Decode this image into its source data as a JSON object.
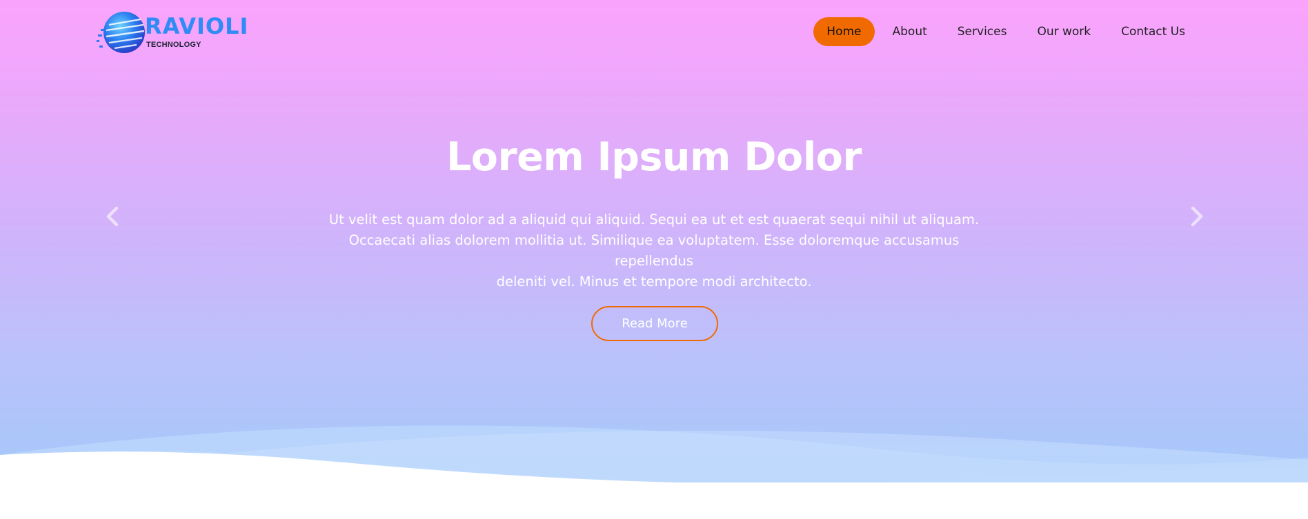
{
  "brand": {
    "name": "RAVIOLI",
    "tagline": "TECHNOLOGY",
    "logo_icon": "globe-logo-icon",
    "name_color": "#2f8cf5"
  },
  "nav": {
    "items": [
      {
        "label": "Home",
        "active": true
      },
      {
        "label": "About",
        "active": false
      },
      {
        "label": "Services",
        "active": false
      },
      {
        "label": "Our work",
        "active": false
      },
      {
        "label": "Contact Us",
        "active": false
      }
    ],
    "active_color": "#f06a00"
  },
  "hero": {
    "title": "Lorem Ipsum Dolor",
    "lines": [
      "Ut velit est quam dolor ad a aliquid qui aliquid. Sequi ea ut et est quaerat sequi nihil ut aliquam.",
      "Occaecati alias dolorem mollitia ut. Similique ea voluptatem. Esse doloremque accusamus repellendus",
      "deleniti vel. Minus et tempore modi architecto."
    ],
    "button_label": "Read More",
    "prev_icon": "chevron-left-icon",
    "next_icon": "chevron-right-icon",
    "gradient_top": "#fba3fd",
    "gradient_bottom": "#a9c9fb",
    "accent": "#f06a00"
  }
}
